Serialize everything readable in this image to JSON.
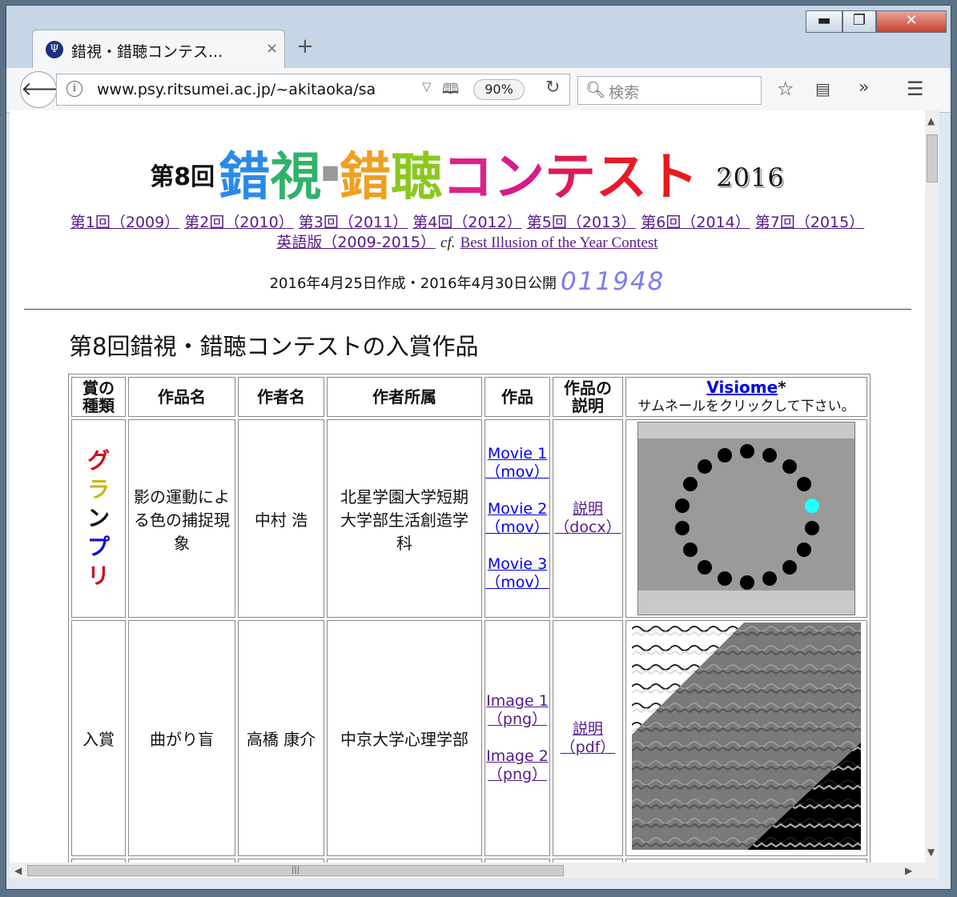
{
  "browser": {
    "tab_title": "錯視・錯聴コンテス...",
    "tab_close": "×",
    "new_tab": "+",
    "url": "www.psy.ritsumei.ac.jp/~akitaoka/sa",
    "zoom": "90%",
    "search_placeholder": "検索",
    "window_minimize": "▬",
    "window_maximize": "❐",
    "window_close": "✕"
  },
  "header": {
    "edition": "第8回",
    "title_chars": [
      {
        "ch": "錯",
        "color": "#2a8ae8"
      },
      {
        "ch": "視",
        "color": "#2fb36a"
      },
      {
        "ch": "錯",
        "color": "#f0a020"
      },
      {
        "ch": "聴",
        "color": "#8ac820"
      },
      {
        "ch": "コ",
        "color": "#e0208a"
      },
      {
        "ch": "ン",
        "color": "#d81a8a"
      },
      {
        "ch": "テ",
        "color": "#e01a50"
      },
      {
        "ch": "ス",
        "color": "#e81a2a"
      },
      {
        "ch": "ト",
        "color": "#e81a1a"
      }
    ],
    "title_sep": "■",
    "year": "2016"
  },
  "past_links": [
    "第1回（2009）",
    "第2回（2010）",
    "第3回（2011）",
    "第4回（2012）",
    "第5回（2013）",
    "第6回（2014）",
    "第7回（2015）"
  ],
  "english_link": "英語版（2009-2015）",
  "cf_label": "cf.",
  "best_illusion_link": "Best Illusion of the Year Contest",
  "dates_text": "2016年4月25日作成・2016年4月30日公開",
  "counter": "011948",
  "section_title": "第8回錯視・錯聴コンテストの入賞作品",
  "table": {
    "headers": {
      "award_type": "賞の種類",
      "work_name": "作品名",
      "author": "作者名",
      "affiliation": "作者所属",
      "work": "作品",
      "explanation": "作品の説明",
      "visiome_link": "Visiome",
      "visiome_star": "*",
      "visiome_note": "サムネールをクリックして下さい。"
    },
    "rows": [
      {
        "award_chars": [
          {
            "ch": "グ",
            "color": "#cc1020"
          },
          {
            "ch": "ラ",
            "color": "#c8b810"
          },
          {
            "ch": "ン",
            "color": "#101010"
          },
          {
            "ch": "プ",
            "color": "#1010cc"
          },
          {
            "ch": "リ",
            "color": "#cc1020"
          }
        ],
        "work_name": "影の運動による色の捕捉現象",
        "author": "中村 浩",
        "affiliation": "北星学園大学短期大学部生活創造学科",
        "works": [
          "Movie 1（mov）",
          "Movie 2（mov）",
          "Movie 3（mov）"
        ],
        "explanation": "説明（docx）"
      },
      {
        "award": "入賞",
        "work_name": "曲がり盲",
        "author": "高橋 康介",
        "affiliation": "中京大学心理学部",
        "works": [
          "Image 1（png）",
          "Image 2（png）"
        ],
        "explanation": "説明（pdf）"
      }
    ]
  },
  "colors": {
    "link": "#551a8b",
    "link_unvisited": "#0000ee",
    "counter": "#7b7bef",
    "cyan_dot": "#22ffff"
  }
}
